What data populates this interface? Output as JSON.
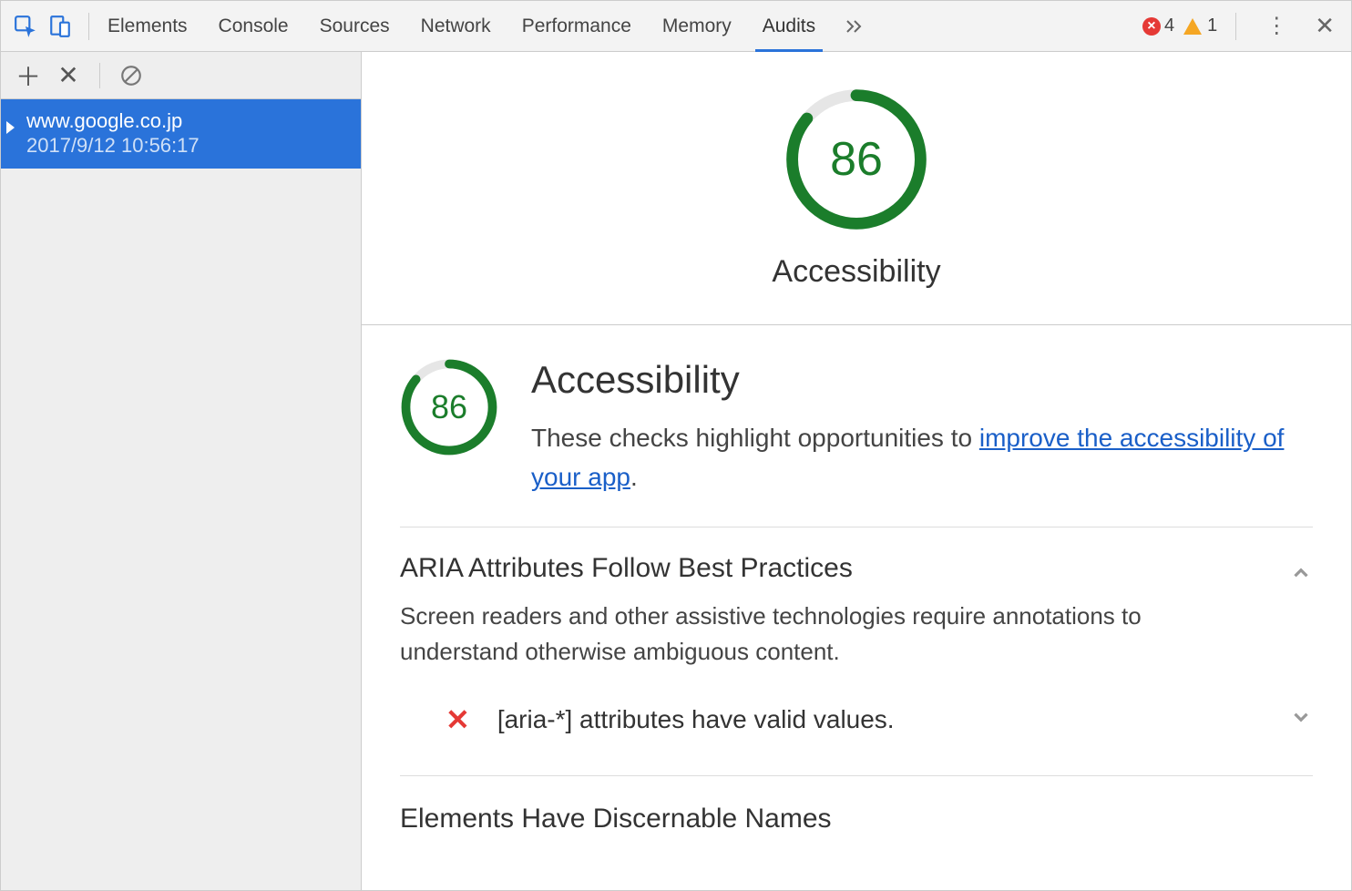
{
  "tabs": {
    "elements": "Elements",
    "console": "Console",
    "sources": "Sources",
    "network": "Network",
    "performance": "Performance",
    "memory": "Memory",
    "audits": "Audits"
  },
  "error_count": "4",
  "warning_count": "1",
  "sidebar": {
    "audit": {
      "title": "www.google.co.jp",
      "date": "2017/9/12 10:56:17"
    }
  },
  "hero": {
    "score": "86",
    "label": "Accessibility"
  },
  "section": {
    "score": "86",
    "title": "Accessibility",
    "desc_pre": "These checks highlight opportunities to ",
    "desc_link": "improve the accessibility of your app",
    "desc_post": "."
  },
  "group1": {
    "title": "ARIA Attributes Follow Best Practices",
    "desc": "Screen readers and other assistive technologies require annotations to understand otherwise ambiguous content.",
    "check1": "[aria-*] attributes have valid values."
  },
  "group2": {
    "title": "Elements Have Discernable Names"
  }
}
